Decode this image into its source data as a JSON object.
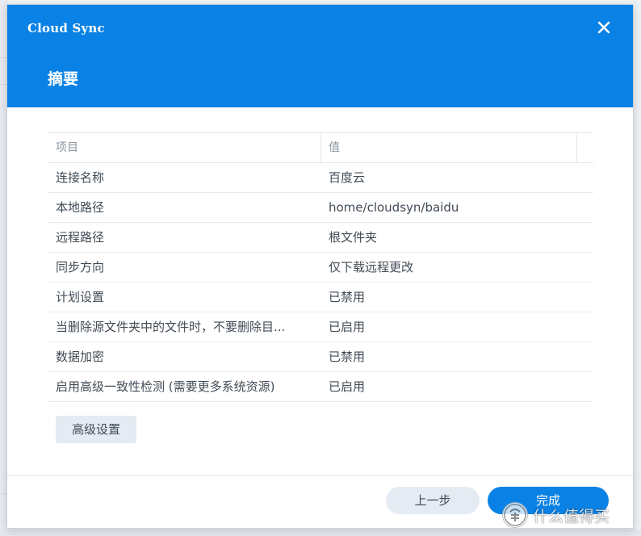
{
  "app": {
    "title": "Cloud Sync",
    "page_title": "摘要"
  },
  "table": {
    "headers": [
      "项目",
      "值"
    ],
    "rows": [
      [
        "连接名称",
        "百度云"
      ],
      [
        "本地路径",
        "home/cloudsyn/baidu"
      ],
      [
        "远程路径",
        "根文件夹"
      ],
      [
        "同步方向",
        "仅下载远程更改"
      ],
      [
        "计划设置",
        "已禁用"
      ],
      [
        "当删除源文件夹中的文件时，不要删除目...",
        "已启用"
      ],
      [
        "数据加密",
        "已禁用"
      ],
      [
        "启用高级一致性检测 (需要更多系统资源)",
        "已启用"
      ]
    ]
  },
  "buttons": {
    "advanced": "高级设置",
    "previous": "上一步",
    "done": "完成"
  },
  "watermark": {
    "text": "什么值得买"
  },
  "colors": {
    "header": "#0a81e4",
    "primary_button": "#0a81e4",
    "secondary_button": "#e4ebf2",
    "text": "#414b55",
    "header_text_muted": "#8a949f"
  },
  "icons": {
    "close": "close-icon",
    "watermark_logo": "smzdm-logo"
  }
}
